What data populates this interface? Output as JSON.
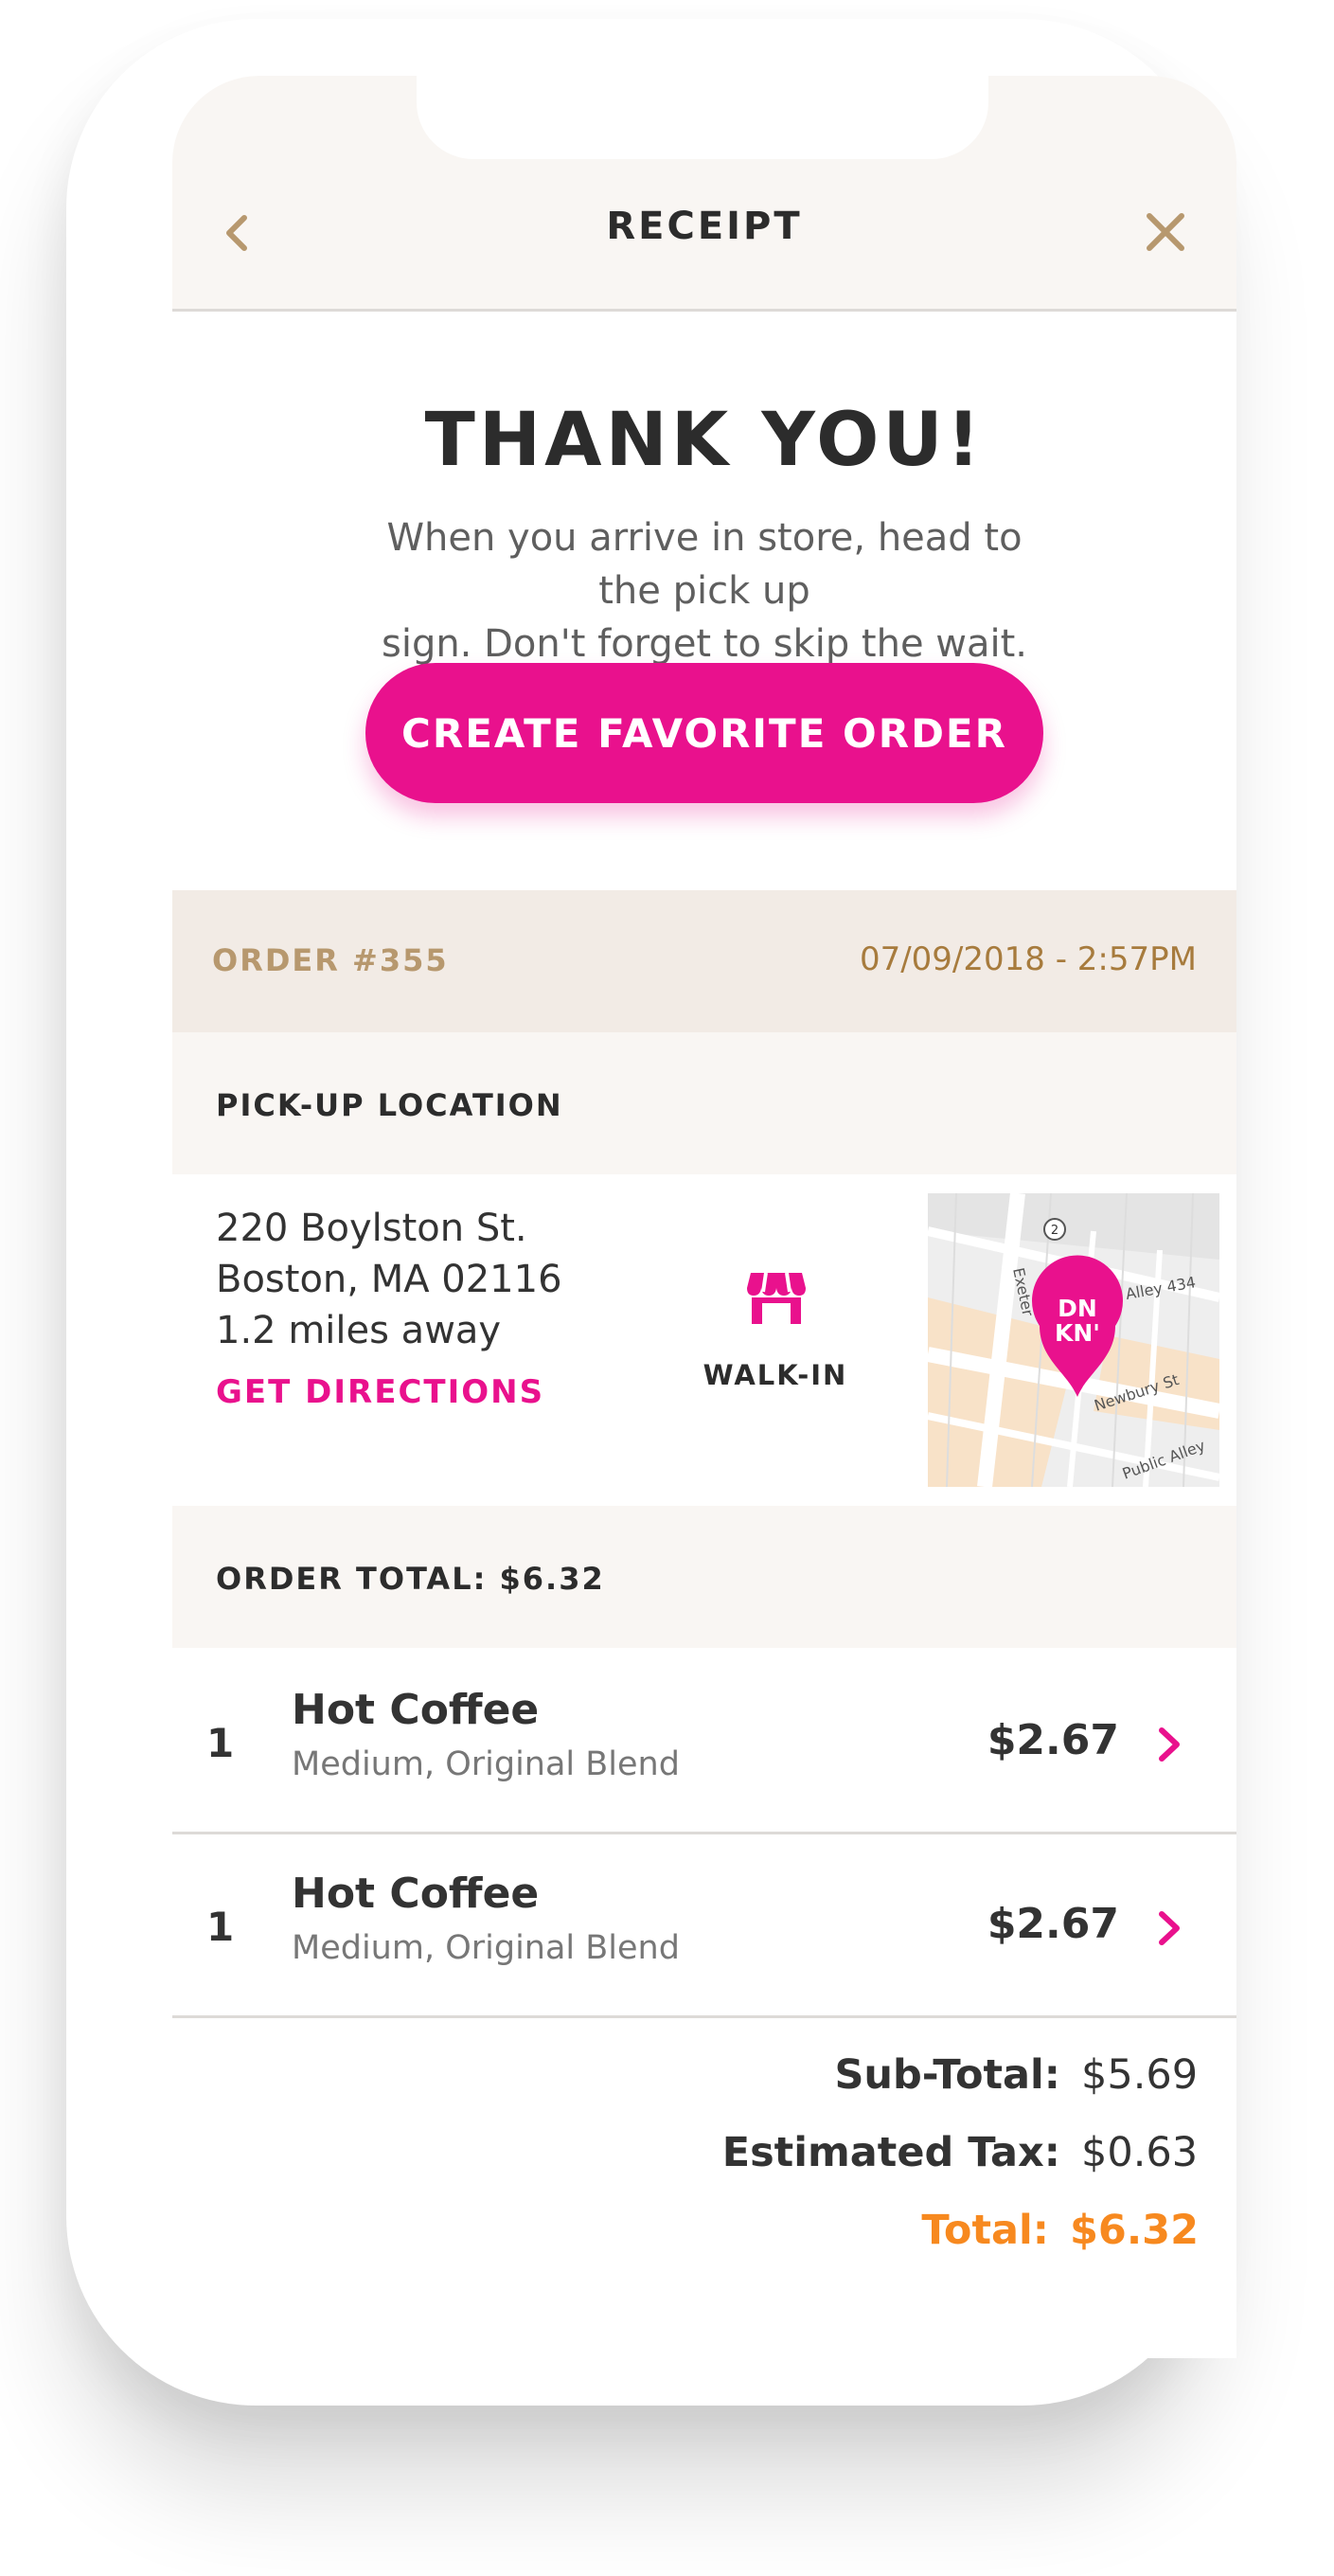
{
  "header": {
    "title": "RECEIPT",
    "back_icon": "chevron-left-icon",
    "close_icon": "close-icon"
  },
  "confirmation": {
    "title": "THANK YOU!",
    "message_line1": "When you arrive in store, head to the pick up",
    "message_line2": "sign. Don't forget to skip the wait.",
    "favorite_button": "CREATE FAVORITE ORDER"
  },
  "order": {
    "number": "ORDER #355",
    "date": "07/09/2018 - 2:57PM"
  },
  "pickup": {
    "section_label": "PICK-UP LOCATION",
    "address_line1": "220 Boylston St.",
    "address_line2": "Boston, MA 02116",
    "distance": "1.2 miles away",
    "directions_link": "GET DIRECTIONS",
    "method": "WALK-IN",
    "method_icon": "storefront-icon",
    "map": {
      "badge_line1": "DN",
      "badge_line2": "KN'",
      "street1": "Exeter",
      "street2": "Alley 434",
      "street3": "Newbury St",
      "street4": "Public Alley",
      "route": "2"
    }
  },
  "summary": {
    "section_label": "ORDER TOTAL: $6.32",
    "items": [
      {
        "qty": "1",
        "name": "Hot Coffee",
        "desc": "Medium, Original Blend",
        "price": "$2.67"
      },
      {
        "qty": "1",
        "name": "Hot Coffee",
        "desc": "Medium, Original Blend",
        "price": "$2.67"
      }
    ],
    "subtotal_label": "Sub-Total:",
    "subtotal_value": "$5.69",
    "tax_label": "Estimated Tax:",
    "tax_value": "$0.63",
    "total_label": "Total:",
    "total_value": "$6.32"
  },
  "colors": {
    "brand_pink": "#e9118d",
    "accent_orange": "#f7891f",
    "tan": "#b7986e",
    "header_bg": "#f9f6f3",
    "order_bar_bg": "#f2ebe5"
  }
}
